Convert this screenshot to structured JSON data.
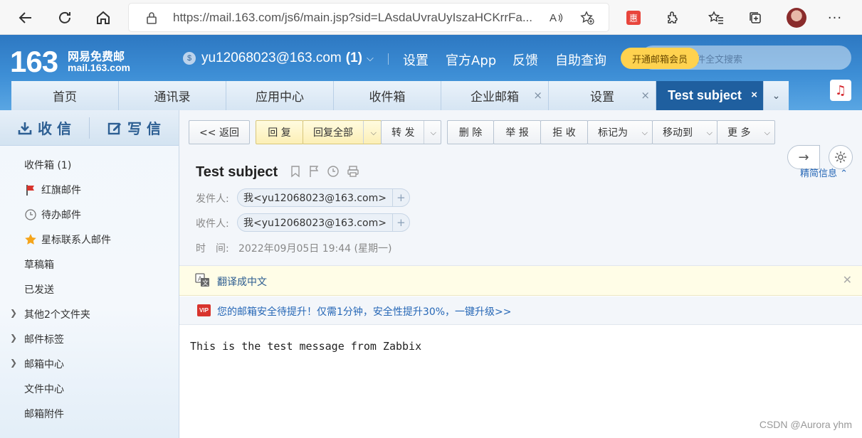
{
  "browser": {
    "url": "https://mail.163.com/js6/main.jsp?sid=LAsdaUvraUyIszaHCKrrFa...",
    "icons": [
      "back-icon",
      "refresh-icon",
      "home-icon",
      "lock-icon",
      "read-aloud-icon",
      "favorite-add-icon",
      "coupon-extension-icon",
      "extensions-icon",
      "favorites-icon",
      "collections-icon",
      "profile-avatar"
    ]
  },
  "header": {
    "logo_number": "163",
    "logo_cn": "网易免费邮",
    "logo_en": "mail.163.com",
    "account": "yu12068023@163.com",
    "unread_count": "(1)",
    "links": [
      "设置",
      "官方App",
      "反馈",
      "自助查询"
    ],
    "vip_button": "开通邮箱会员",
    "search_placeholder": "件全文搜索"
  },
  "tabs": [
    {
      "label": "首页"
    },
    {
      "label": "通讯录"
    },
    {
      "label": "应用中心"
    },
    {
      "label": "收件箱"
    },
    {
      "label": "企业邮箱"
    },
    {
      "label": "设置"
    },
    {
      "label": "Test subject"
    }
  ],
  "tab_close": "×",
  "sidebar": {
    "receive": "收 信",
    "compose": "写 信",
    "folders": [
      {
        "label": "收件箱 (1)"
      },
      {
        "label": "红旗邮件"
      },
      {
        "label": "待办邮件"
      },
      {
        "label": "星标联系人邮件"
      },
      {
        "label": "草稿箱"
      },
      {
        "label": "已发送"
      },
      {
        "label": "其他2个文件夹"
      },
      {
        "label": "邮件标签"
      },
      {
        "label": "邮箱中心"
      },
      {
        "label": "文件中心"
      },
      {
        "label": "邮箱附件"
      }
    ]
  },
  "toolbar": {
    "back": "<< 返回",
    "reply": "回 复",
    "reply_all": "回复全部",
    "forward": "转 发",
    "delete": "删 除",
    "report": "举 报",
    "reject": "拒 收",
    "mark_as": "标记为",
    "move_to": "移动到",
    "more": "更 多"
  },
  "message": {
    "subject": "Test subject",
    "from_label": "发件人:",
    "from_value": "我<yu12068023@163.com>",
    "to_label": "收件人:",
    "to_value": "我<yu12068023@163.com>",
    "time_label": "时　间:",
    "time_value": "2022年09月05日 19:44 (星期一)",
    "detail_link": "精简信息",
    "translate": "翻译成中文",
    "security_tag": "VIP",
    "security_notice": "您的邮箱安全待提升！仅需1分钟，安全性提升30%，一键升级>>",
    "body": "This is the test message from Zabbix"
  },
  "watermark": "CSDN @Aurora yhm",
  "colors": {
    "header_blue": "#2d78c2",
    "active_tab": "#1f5f9f",
    "vip_yellow": "#ffd24f",
    "link_blue": "#2667b6",
    "flag_red": "#d8342d"
  }
}
